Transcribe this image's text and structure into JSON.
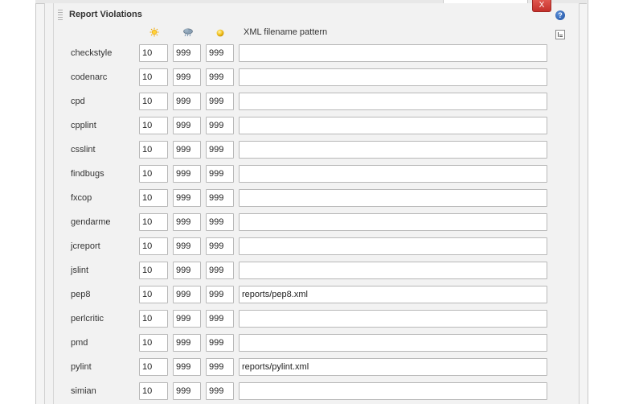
{
  "section": {
    "title": "Report Violations",
    "delete_label": "X",
    "help_label": "?"
  },
  "header": {
    "healthy_icon": "sun-icon",
    "unhealthy_icon": "cloud-storm-icon",
    "unstable_icon": "yellow-orb-icon",
    "pattern_label": "XML filename pattern"
  },
  "colors": {
    "delete_button": "#d9534f",
    "help_icon": "#2a5db0",
    "panel_background": "#f2f2f2"
  },
  "rows": [
    {
      "name": "checkstyle",
      "healthy": "10",
      "unhealthy": "999",
      "unstable": "999",
      "pattern": ""
    },
    {
      "name": "codenarc",
      "healthy": "10",
      "unhealthy": "999",
      "unstable": "999",
      "pattern": ""
    },
    {
      "name": "cpd",
      "healthy": "10",
      "unhealthy": "999",
      "unstable": "999",
      "pattern": ""
    },
    {
      "name": "cpplint",
      "healthy": "10",
      "unhealthy": "999",
      "unstable": "999",
      "pattern": ""
    },
    {
      "name": "csslint",
      "healthy": "10",
      "unhealthy": "999",
      "unstable": "999",
      "pattern": ""
    },
    {
      "name": "findbugs",
      "healthy": "10",
      "unhealthy": "999",
      "unstable": "999",
      "pattern": ""
    },
    {
      "name": "fxcop",
      "healthy": "10",
      "unhealthy": "999",
      "unstable": "999",
      "pattern": ""
    },
    {
      "name": "gendarme",
      "healthy": "10",
      "unhealthy": "999",
      "unstable": "999",
      "pattern": ""
    },
    {
      "name": "jcreport",
      "healthy": "10",
      "unhealthy": "999",
      "unstable": "999",
      "pattern": ""
    },
    {
      "name": "jslint",
      "healthy": "10",
      "unhealthy": "999",
      "unstable": "999",
      "pattern": ""
    },
    {
      "name": "pep8",
      "healthy": "10",
      "unhealthy": "999",
      "unstable": "999",
      "pattern": "reports/pep8.xml"
    },
    {
      "name": "perlcritic",
      "healthy": "10",
      "unhealthy": "999",
      "unstable": "999",
      "pattern": ""
    },
    {
      "name": "pmd",
      "healthy": "10",
      "unhealthy": "999",
      "unstable": "999",
      "pattern": ""
    },
    {
      "name": "pylint",
      "healthy": "10",
      "unhealthy": "999",
      "unstable": "999",
      "pattern": "reports/pylint.xml"
    },
    {
      "name": "simian",
      "healthy": "10",
      "unhealthy": "999",
      "unstable": "999",
      "pattern": ""
    }
  ]
}
